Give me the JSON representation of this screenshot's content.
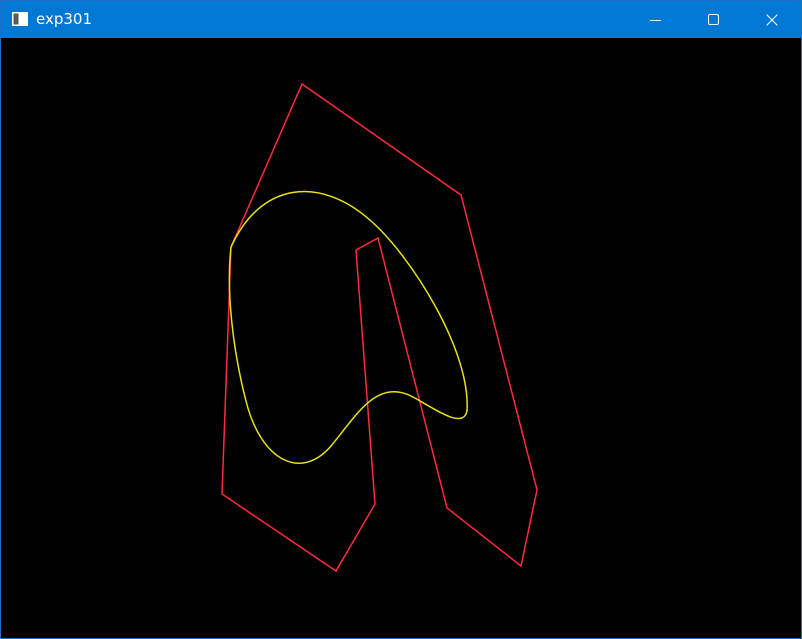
{
  "window": {
    "title": "exp301",
    "icon": "app-window-icon",
    "controls": [
      "minimize-icon",
      "maximize-icon",
      "close-icon"
    ]
  },
  "canvas": {
    "background": "#000000",
    "control_polygon_color": "#ff2a3c",
    "curve_color": "#e6e21a"
  }
}
